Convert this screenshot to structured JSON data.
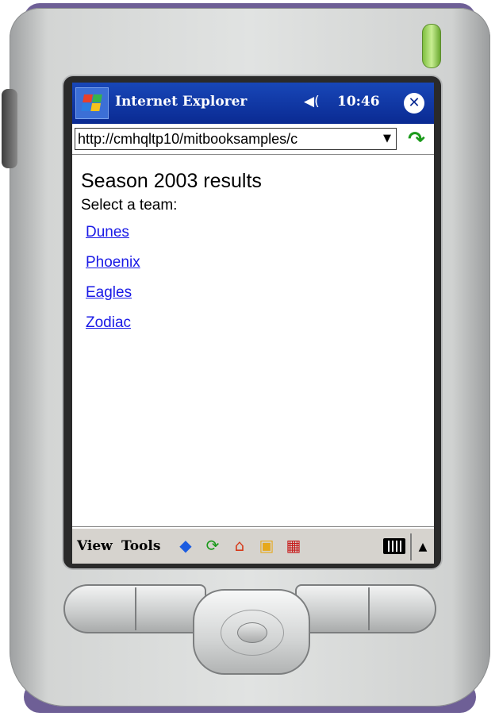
{
  "window": {
    "app_title": "Internet Explorer",
    "time": "10:46",
    "icons": {
      "start": "windows-flag-icon",
      "speaker": "speaker-icon",
      "close": "close-icon"
    }
  },
  "address_bar": {
    "url": "http://cmhqltp10/mitbooksamples/c",
    "dropdown_glyph": "▼",
    "go_icon": "go-arrow-icon"
  },
  "page": {
    "heading": "Season 2003 results",
    "prompt": "Select a team:",
    "teams": [
      "Dunes",
      "Phoenix",
      "Eagles",
      "Zodiac"
    ],
    "link_color": "#1a1ae6"
  },
  "command_bar": {
    "menus": [
      "View",
      "Tools"
    ],
    "toolbar_icons": [
      "back-icon",
      "refresh-icon",
      "home-icon",
      "favorites-icon",
      "show-pictures-icon"
    ],
    "input_panel_icon": "keyboard-icon",
    "sip_toggle_glyph": "▲"
  },
  "colors": {
    "titlebar": "#0a2a92",
    "device_strap": "#6e5f96",
    "stylus": "#7fc040"
  }
}
